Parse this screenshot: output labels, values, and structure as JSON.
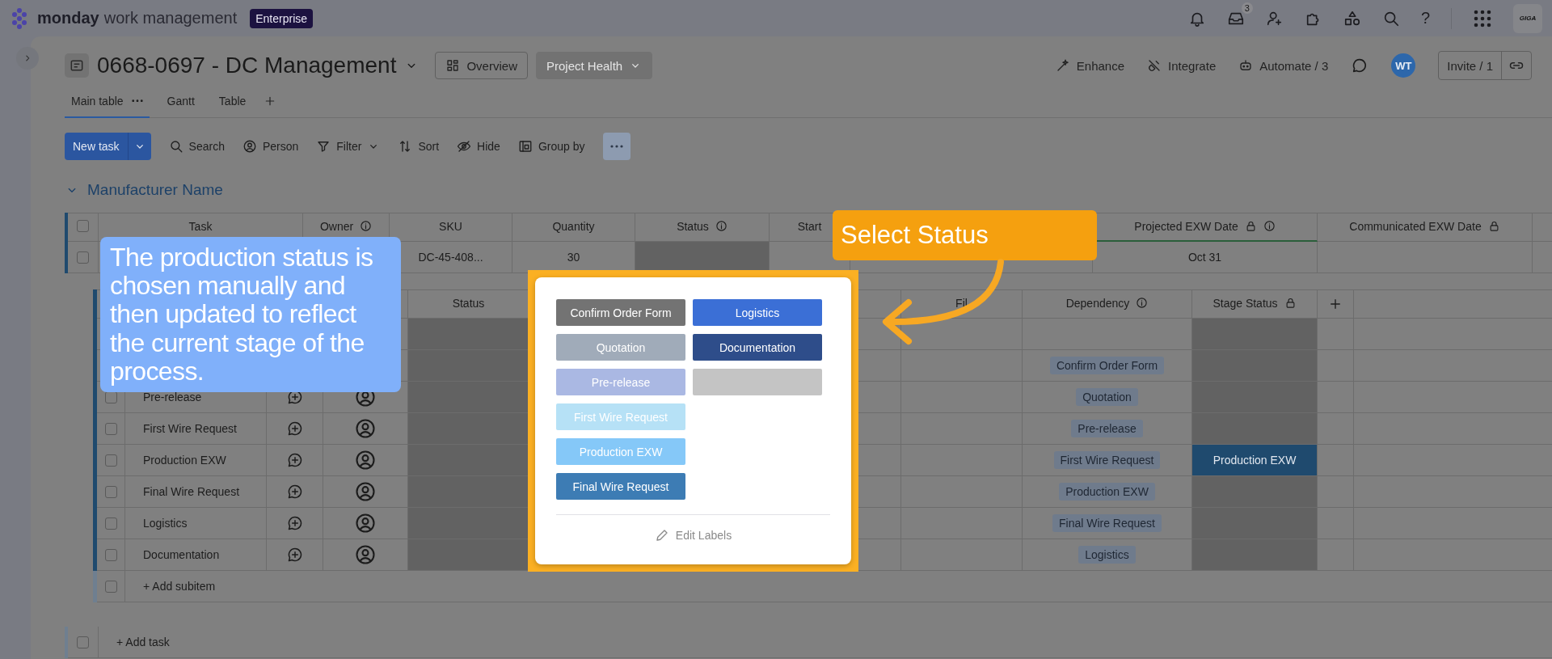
{
  "top_bar": {
    "brand": "monday",
    "product": "work management",
    "plan": "Enterprise",
    "inbox_count": "3",
    "help": "?",
    "account": "GIGA"
  },
  "board": {
    "title": "0668-0697 - DC Management",
    "view_buttons": [
      {
        "label": "Overview",
        "kind": "outline"
      },
      {
        "label": "Project Health",
        "kind": "filled"
      }
    ],
    "actions": [
      {
        "label": "Enhance",
        "kind": "wand"
      },
      {
        "label": "Integrate",
        "kind": "plug"
      },
      {
        "label": "Automate / 3",
        "kind": "robot"
      }
    ],
    "avatar": "WT",
    "invite": "Invite / 1"
  },
  "tabs": [
    {
      "label": "Main table",
      "selected": true
    },
    {
      "label": "Gantt",
      "selected": false
    },
    {
      "label": "Table",
      "selected": false
    }
  ],
  "toolbar": {
    "new_task": "New task",
    "tools": [
      {
        "label": "Search",
        "kind": "search"
      },
      {
        "label": "Person",
        "kind": "person"
      },
      {
        "label": "Filter",
        "kind": "filter"
      },
      {
        "label": "Sort",
        "kind": "sort"
      },
      {
        "label": "Hide",
        "kind": "hide"
      },
      {
        "label": "Group by",
        "kind": "group"
      }
    ]
  },
  "group": {
    "name": "Manufacturer Name",
    "checked": false,
    "columns": [
      {
        "label": "Task",
        "info": false,
        "locked": false
      },
      {
        "label": "Owner",
        "info": true,
        "locked": false
      },
      {
        "label": "SKU",
        "info": false,
        "locked": false
      },
      {
        "label": "Quantity",
        "info": false,
        "locked": false
      },
      {
        "label": "Status",
        "info": true,
        "locked": false
      },
      {
        "label": "Start",
        "info": false,
        "locked": false
      },
      {
        "label": "Projected EXW Date",
        "info": true,
        "locked": true
      },
      {
        "label": "Communicated EXW Date",
        "info": false,
        "locked": true
      }
    ],
    "row": {
      "checked": false,
      "sku": "DC-45-408...",
      "quantity": "30",
      "projected_exw": "Oct 31"
    }
  },
  "subitems": {
    "columns": [
      {
        "label": "Status",
        "info": false,
        "locked": false
      },
      {
        "label": "Fil",
        "info": false,
        "locked": false
      },
      {
        "label": "Dependency",
        "info": true,
        "locked": false
      },
      {
        "label": "Stage Status",
        "info": false,
        "locked": true
      }
    ],
    "rows": [
      {},
      {
        "dependency": "Confirm Order Form"
      },
      {
        "checked": false,
        "name": "Pre-release",
        "dependency": "Quotation"
      },
      {
        "checked": false,
        "name": "First Wire Request",
        "dependency": "Pre-release"
      },
      {
        "checked": false,
        "name": "Production EXW",
        "dependency": "First Wire Request",
        "stage_status": {
          "label": "Production EXW",
          "color": "#1f4a6e"
        }
      },
      {
        "checked": false,
        "name": "Final Wire Request",
        "dependency": "Production EXW"
      },
      {
        "checked": false,
        "name": "Logistics",
        "dependency": "Final Wire Request"
      },
      {
        "checked": false,
        "name": "Documentation",
        "dependency": "Logistics"
      }
    ],
    "add_subitem": {
      "label": "+ Add subitem",
      "checked": false
    }
  },
  "add_task": {
    "label": "+ Add task",
    "checked": false
  },
  "status_picker": {
    "columns": [
      [
        {
          "label": "Confirm Order Form",
          "color": "#737373"
        },
        {
          "label": "Quotation",
          "color": "#a0abb9"
        },
        {
          "label": "Pre-release",
          "color": "#aab8e3"
        },
        {
          "label": "First Wire Request",
          "color": "#b6e1f6"
        },
        {
          "label": "Production EXW",
          "color": "#85c8f8"
        },
        {
          "label": "Final Wire Request",
          "color": "#3d7cb4"
        }
      ],
      [
        {
          "label": "Logistics",
          "color": "#3b6fd6"
        },
        {
          "label": "Documentation",
          "color": "#2e4d8a"
        },
        {
          "color": "#c4c4c4"
        }
      ]
    ],
    "edit_label": "Edit Labels"
  },
  "callouts": {
    "note": "The production status is chosen manually and then updated to reflect the current stage of the process.",
    "pointer": "Select Status"
  }
}
